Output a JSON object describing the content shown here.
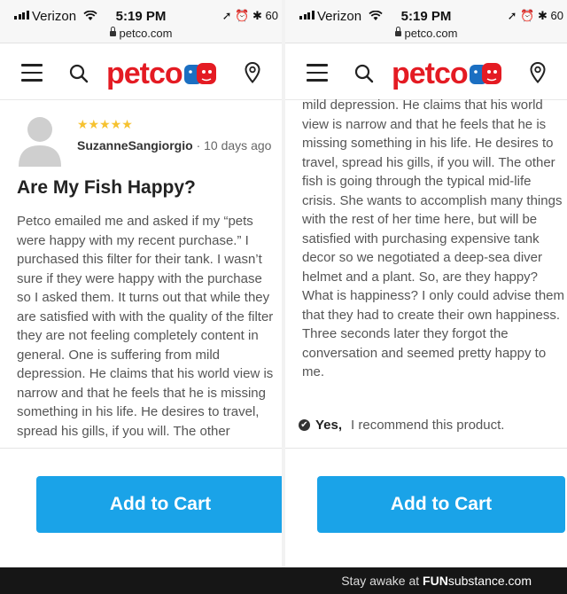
{
  "status_bar": {
    "carrier": "Verizon",
    "time": "5:19 PM",
    "battery": "60",
    "url": "petco.com"
  },
  "header": {
    "logo": "petco"
  },
  "review": {
    "author": "SuzanneSangiorgio",
    "date": "10 days ago",
    "rating": 5,
    "stars": "★★★★★",
    "title": "Are My Fish Happy?",
    "body_left": "Petco emailed me and asked if my “pets were happy with my recent purchase.” I purchased this filter for their tank. I wasn’t sure if they were happy with the purchase so I asked them. It turns out that while they are satisfied with with the quality of the filter they are not feeling completely content in general. One is suffering from mild depression. He claims that his world view is narrow and that he feels that he is missing something in his life. He desires to travel, spread his gills, if you will. The other",
    "body_right": "mild depression. He claims that his world view is narrow and that he feels that he is missing something in his life. He desires to travel, spread his gills, if you will. The other fish is going through the typical mid-life crisis. She wants to accomplish many things with the rest of her time here, but will be satisfied with purchasing expensive tank decor so we negotiated a deep-sea diver helmet and a plant. So, are they happy? What is happiness? I only could advise them that they had to create their own happiness. Three seconds later they forgot the conversation and seemed pretty happy to me.",
    "recommend_yes": "Yes,",
    "recommend_text": "I recommend this product."
  },
  "cart": {
    "label": "Add to Cart"
  },
  "footer": {
    "tagline": "Stay awake at",
    "brand_fun": "FUN",
    "brand_sub": "substance.com"
  },
  "colors": {
    "petco_red": "#e41b23",
    "petco_blue": "#1b6fc2",
    "cart_blue": "#1aa3e8",
    "star_gold": "#f6c230"
  }
}
